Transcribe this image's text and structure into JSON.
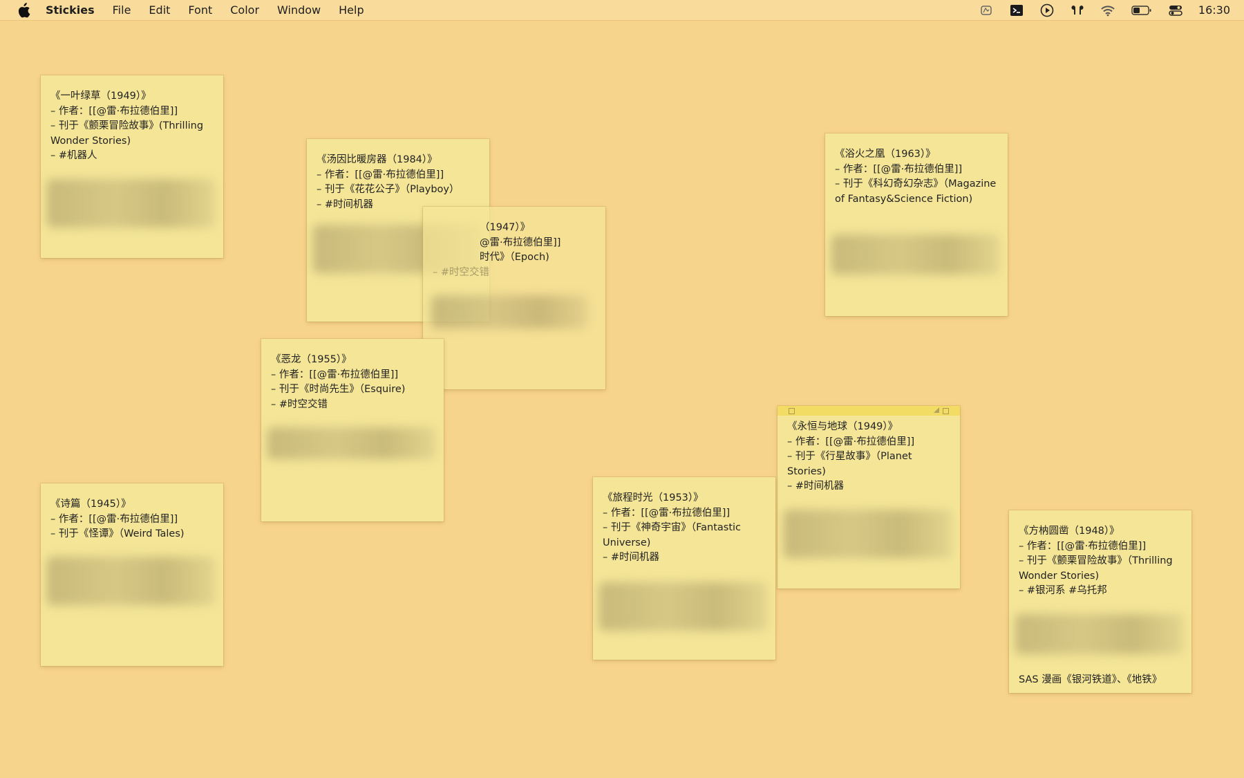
{
  "menubar": {
    "app_name": "Stickies",
    "items": [
      "File",
      "Edit",
      "Font",
      "Color",
      "Window",
      "Help"
    ],
    "clock": "16:30",
    "status_icons": [
      "unknown-app-icon",
      "terminal-icon",
      "play-icon",
      "airpods-icon",
      "wifi-icon",
      "battery-icon",
      "control-center-icon"
    ]
  },
  "notes": [
    {
      "lines": [
        "《一叶绿草（1949）》",
        "– 作者：[[@雷·布拉德伯里]]",
        "– 刊于《颤栗冒险故事》(Thrilling Wonder Stories)",
        "– #机器人"
      ]
    },
    {
      "lines": [
        "《汤因比暖房器（1984）》",
        "– 作者：[[@雷·布拉德伯里]]",
        "– 刊于《花花公子》（Playboy）",
        "– #时间机器"
      ]
    },
    {
      "lines": [
        "（1947）》",
        "@雷·布拉德伯里]]",
        "时代》（Epoch)",
        "– #时空交错"
      ]
    },
    {
      "lines": [
        "《浴火之凰（1963）》",
        "– 作者：[[@雷·布拉德伯里]]",
        "– 刊于《科幻奇幻杂志》（Magazine of Fantasy&Science Fiction)"
      ]
    },
    {
      "lines": [
        "《恶龙（1955）》",
        "– 作者：[[@雷·布拉德伯里]]",
        "– 刊于《时尚先生》（Esquire)",
        "– #时空交错"
      ]
    },
    {
      "lines": [
        "《永恒与地球（1949）》",
        "– 作者：[[@雷·布拉德伯里]]",
        "– 刊于《行星故事》（Planet Stories)",
        "– #时间机器"
      ]
    },
    {
      "lines": [
        "《诗篇（1945）》",
        "– 作者：[[@雷·布拉德伯里]]",
        "– 刊于《怪谭》（Weird Tales)"
      ]
    },
    {
      "lines": [
        "《旅程时光（1953）》",
        "– 作者：[[@雷·布拉德伯里]]",
        "– 刊于《神奇宇宙》（Fantastic Universe)",
        "– #时间机器"
      ]
    },
    {
      "lines": [
        "《方枘圆凿（1948）》",
        "– 作者：[[@雷·布拉德伯里]]",
        "– 刊于《颤栗冒险故事》（Thrilling Wonder Stories)",
        "– #银河系 #乌托邦"
      ],
      "footer": "SAS 漫画《银河铁道》、《地铁》"
    }
  ]
}
